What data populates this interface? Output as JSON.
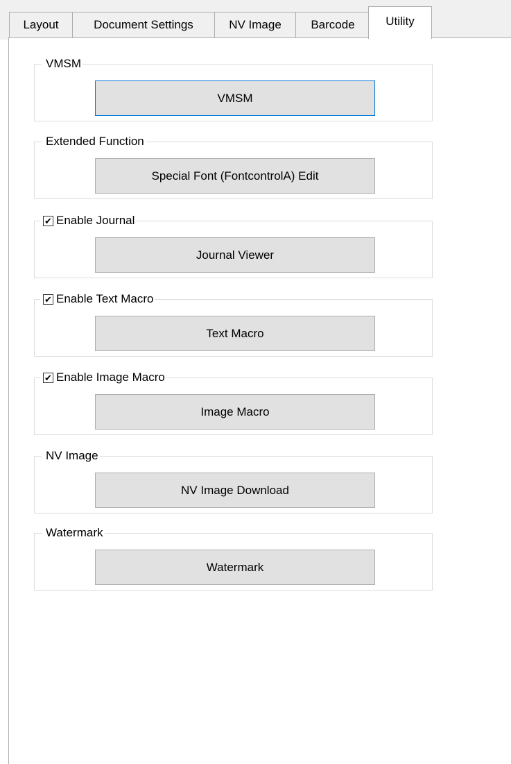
{
  "tabs": [
    {
      "label": "Layout",
      "active": false
    },
    {
      "label": "Document Settings",
      "active": false
    },
    {
      "label": "NV Image",
      "active": false
    },
    {
      "label": "Barcode",
      "active": false
    },
    {
      "label": "Utility",
      "active": true
    }
  ],
  "groups": {
    "vmsm": {
      "title": "VMSM",
      "button": "VMSM"
    },
    "extended_function": {
      "title": "Extended Function",
      "button": "Special Font (FontcontrolA) Edit"
    },
    "journal": {
      "title": "Enable Journal",
      "checked": true,
      "button": "Journal Viewer"
    },
    "text_macro": {
      "title": "Enable Text Macro",
      "checked": true,
      "button": "Text Macro"
    },
    "image_macro": {
      "title": "Enable Image Macro",
      "checked": true,
      "button": "Image Macro"
    },
    "nv_image": {
      "title": "NV Image",
      "button": "NV Image Download"
    },
    "watermark": {
      "title": "Watermark",
      "button": "Watermark"
    }
  },
  "colors": {
    "window_bg": "#f0f0f0",
    "panel_bg": "#ffffff",
    "button_bg": "#e1e1e1",
    "button_border": "#adadad",
    "focus_border": "#0078d7",
    "group_border": "#dcdcdc"
  }
}
